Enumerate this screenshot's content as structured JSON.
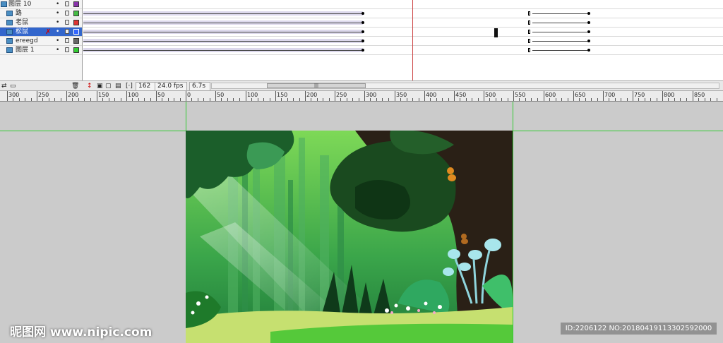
{
  "layers": [
    {
      "name": "图层 10",
      "color": "#8833aa",
      "selected": false
    },
    {
      "name": "路",
      "color": "#44bb44",
      "selected": false
    },
    {
      "name": "老鼠",
      "color": "#dd3333",
      "selected": false
    },
    {
      "name": "松鼠",
      "color": "#3366ff",
      "selected": true
    },
    {
      "name": "ereegd",
      "color": "#666666",
      "selected": false
    },
    {
      "name": "图层 1",
      "color": "#33cc33",
      "selected": false
    }
  ],
  "status": {
    "frame": "162",
    "fps": "24.0 fps",
    "time": "6.7s"
  },
  "ruler_labels": [
    "300",
    "250",
    "200",
    "150",
    "100",
    "50",
    "0",
    "50",
    "100",
    "150",
    "200",
    "250",
    "300",
    "350",
    "400",
    "450",
    "500",
    "550",
    "600",
    "650",
    "700",
    "750",
    "800",
    "850"
  ],
  "colors": {
    "accent": "#3366cc",
    "guide": "#33cc33",
    "playhead": "#cc4444"
  },
  "watermark": {
    "brand": "昵图网",
    "site": "www.nipic.com",
    "id": "ID:2206122 NO:20180419113302592000"
  }
}
